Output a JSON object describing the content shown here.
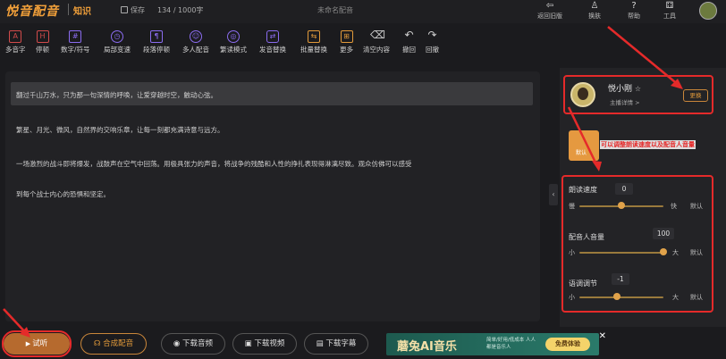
{
  "topbar": {
    "logo": "悦音配音",
    "logo_sub": "知识",
    "save_label": "保存",
    "word_count": "134 / 1000字",
    "doc_title": "未命名配音",
    "actions": [
      {
        "label": "返回旧版",
        "icon": "back-icon"
      },
      {
        "label": "换肤",
        "icon": "shirt-icon"
      },
      {
        "label": "帮助",
        "icon": "help-icon"
      },
      {
        "label": "工具",
        "icon": "tools-icon"
      }
    ]
  },
  "toolbar": {
    "items": [
      {
        "label": "多音字",
        "glyph": "A",
        "icon": "polyphone-icon"
      },
      {
        "label": "停顿",
        "glyph": "H",
        "icon": "pause-icon"
      },
      {
        "label": "数字/符号",
        "glyph": "#",
        "icon": "number-icon"
      },
      {
        "label": "局部变速",
        "glyph": "◷",
        "icon": "speed-icon"
      },
      {
        "label": "段落停顿",
        "glyph": "¶",
        "icon": "paragraph-pause-icon"
      },
      {
        "label": "多人配音",
        "glyph": "☺",
        "icon": "multi-voice-icon"
      },
      {
        "label": "繁读模式",
        "glyph": "◎",
        "icon": "mode-icon"
      },
      {
        "label": "发音替换",
        "glyph": "⇄",
        "icon": "replace-icon"
      },
      {
        "label": "批量替换",
        "glyph": "⇆",
        "icon": "batch-replace-icon"
      },
      {
        "label": "更多",
        "glyph": "⊞",
        "icon": "more-icon"
      },
      {
        "label": "清空内容",
        "glyph": "⌫",
        "icon": "clear-icon"
      },
      {
        "label": "撤回",
        "glyph": "↶",
        "icon": "undo-icon"
      },
      {
        "label": "回撤",
        "glyph": "↷",
        "icon": "redo-icon"
      }
    ]
  },
  "editor": {
    "paragraphs": [
      "翻过千山万水，只为那一句深情的呼唤，让爱穿越时空，触动心弦。",
      "繁星、月光、微风，自然界的交响乐章，让每一刻都充满诗意与远方。",
      "一场激烈的战斗即将爆发，战鼓声在空气中回荡。用极具张力的声音，将战争的残酷和人性的挣扎表现得淋漓尽致。观众仿佛可以感受",
      "到每个战士内心的恐惧和坚定。"
    ]
  },
  "bottombar": {
    "trial_label": "试听",
    "synth_label": "合成配音",
    "dl_audio": "下载音频",
    "dl_video": "下载视频",
    "dl_subtitle": "下载字幕",
    "banner_title": "蘑兔AI音乐",
    "banner_sub": "简单/好用/低成本 人人都是音乐人",
    "banner_btn": "免费体验",
    "banner_close": "✕"
  },
  "panel": {
    "voice_name": "悦小刚",
    "voice_detail": "主播详情 >",
    "change_label": "更换",
    "thumb_label": "默认",
    "annotation": "可以调整朗读速度以及配音人音量",
    "controls": [
      {
        "label": "朗读速度",
        "value": "0",
        "min": "慢",
        "max": "快",
        "default": "默认",
        "level": 0.5
      },
      {
        "label": "配音人音量",
        "value": "100",
        "min": "小",
        "max": "大",
        "default": "默认",
        "level": 1.0
      },
      {
        "label": "语调调节",
        "value": "-1",
        "min": "小",
        "max": "大",
        "default": "默认",
        "level": 0.45
      }
    ]
  },
  "colors": {
    "accent": "#e29a3a",
    "annotation_red": "#e52a2a"
  }
}
